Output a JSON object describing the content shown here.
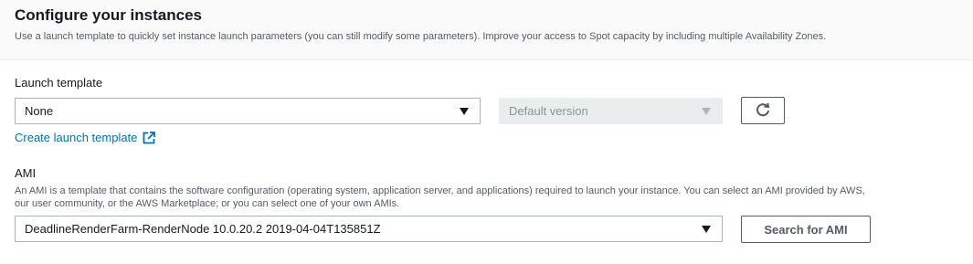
{
  "header": {
    "title": "Configure your instances",
    "subtitle": "Use a launch template to quickly set instance launch parameters (you can still modify some parameters). Improve your access to Spot capacity by including multiple Availability Zones."
  },
  "launch_template": {
    "label": "Launch template",
    "selected": "None",
    "version_placeholder": "Default version",
    "refresh_icon": "refresh-icon",
    "create_link": "Create launch template",
    "external_icon": "external-link-icon"
  },
  "ami": {
    "label": "AMI",
    "description_line1": "An AMI is a template that contains the software configuration (operating system, application server, and applications) required to launch your instance. You can select an AMI provided by AWS,",
    "description_line2": "our user community, or the AWS Marketplace; or you can select one of your own AMIs.",
    "selected": "DeadlineRenderFarm-RenderNode 10.0.20.2 2019-04-04T135851Z",
    "search_button": "Search for AMI"
  },
  "colors": {
    "link": "#0073bb",
    "text": "#16191f",
    "muted": "#545b64",
    "border": "#aab7b8"
  }
}
